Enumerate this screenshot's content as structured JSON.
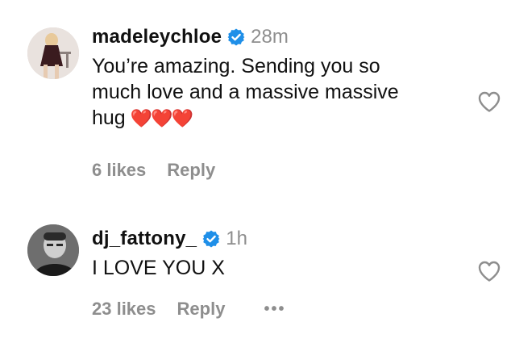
{
  "comments": [
    {
      "username": "madeleychloe",
      "time": "28m",
      "text": "You’re amazing. Sending you so\nmuch love and a massive massive\nhug",
      "emoji": "❤️❤️❤️",
      "likes": "6 likes",
      "reply": "Reply"
    },
    {
      "username": "dj_fattony_",
      "time": "1h",
      "text": "I LOVE YOU X",
      "likes": "23 likes",
      "reply": "Reply",
      "more": "•••"
    }
  ],
  "colors": {
    "verified": "#1f8fe8",
    "muted": "#8e8e8e",
    "heart_emoji": "#e0262e"
  },
  "icons": {
    "verified": "verified-badge-icon",
    "like": "heart-outline-icon",
    "more": "more-options-icon"
  }
}
